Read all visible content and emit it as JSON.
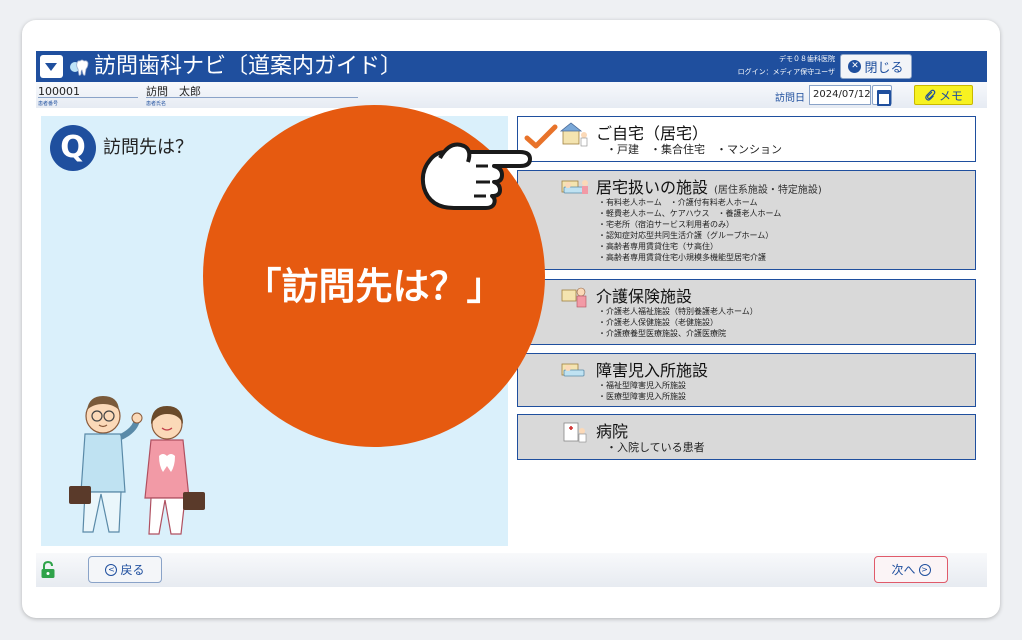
{
  "header": {
    "app_title": "訪問歯科ナビ〔道案内ガイド〕",
    "clinic": "デモ０８歯科医院",
    "login": "ログイン：メディア保守ユーザ",
    "close_label": "閉じる"
  },
  "patient": {
    "id": "100001",
    "id_caption": "患者番号",
    "name": "訪問　太郎",
    "name_caption": "患者氏名",
    "visit_date_label": "訪問日",
    "visit_date": "2024/07/12",
    "memo_label": "メモ"
  },
  "question": {
    "badge": "Q",
    "text": "訪問先は？",
    "overlay": "「訪問先は？」"
  },
  "options": [
    {
      "title": "ご自宅（居宅）",
      "subtitle": "",
      "items": [
        "・戸建　・集合住宅　・マンション"
      ],
      "selected": true,
      "icon": "house-icon"
    },
    {
      "title": "居宅扱いの施設",
      "subtitle": "(居住系施設・特定施設)",
      "items": [
        "・有料老人ホーム　・介護付有料老人ホーム",
        "・軽費老人ホーム、ケアハウス　・養護老人ホーム",
        "・宅老所（宿泊サービス利用者のみ）",
        "・認知症対応型共同生活介護（グループホーム）",
        "・高齢者専用賃貸住宅（サ高住）",
        "・高齢者専用賃貸住宅小規模多機能型居宅介護"
      ],
      "selected": false,
      "icon": "bed-icon"
    },
    {
      "title": "介護保険施設",
      "subtitle": "",
      "items": [
        "・介護老人福祉施設（特別養護老人ホーム）",
        "・介護老人保健施設（老健施設）",
        "・介護療養型医療施設、介護医療院"
      ],
      "selected": false,
      "icon": "caregiver-icon"
    },
    {
      "title": "障害児入所施設",
      "subtitle": "",
      "items": [
        "・福祉型障害児入所施設",
        "・医療型障害児入所施設"
      ],
      "selected": false,
      "icon": "bed-icon"
    },
    {
      "title": "病院",
      "subtitle": "",
      "items": [
        "・入院している患者"
      ],
      "selected": false,
      "icon": "hospital-icon"
    }
  ],
  "footer": {
    "back_label": "戻る",
    "next_label": "次へ"
  },
  "colors": {
    "brand": "#1f4f9e",
    "accent": "#e65a10",
    "panel": "#daf0fb",
    "memo": "#f7f221"
  }
}
